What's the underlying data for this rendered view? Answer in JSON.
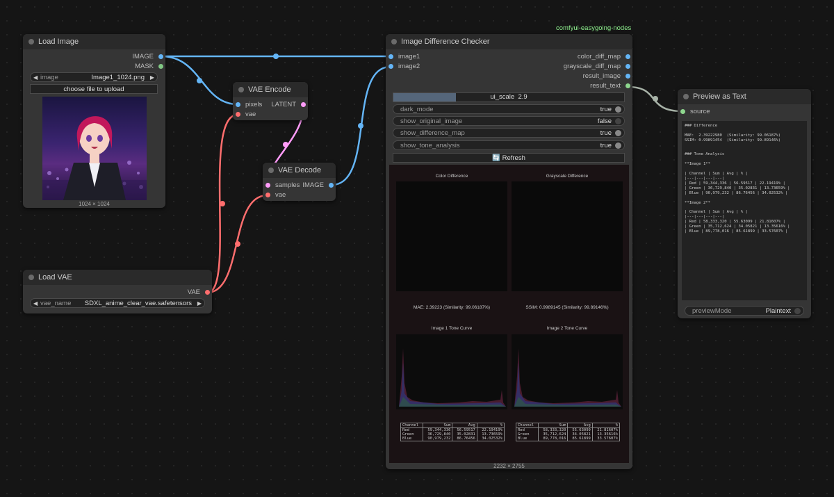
{
  "group_label": "comfyui-easygoing-nodes",
  "nodes": {
    "load_image": {
      "title": "Load Image",
      "out_image": "IMAGE",
      "out_mask": "MASK",
      "image_label": "image",
      "image_value": "Image1_1024.png",
      "upload_label": "choose file to upload",
      "dims": "1024 × 1024"
    },
    "vae_encode": {
      "title": "VAE Encode",
      "in_pixels": "pixels",
      "in_vae": "vae",
      "out_latent": "LATENT"
    },
    "vae_decode": {
      "title": "VAE Decode",
      "in_samples": "samples",
      "in_vae": "vae",
      "out_image": "IMAGE"
    },
    "load_vae": {
      "title": "Load VAE",
      "out_vae": "VAE",
      "vae_name_label": "vae_name",
      "vae_name_value": "SDXL_anime_clear_vae.safetensors"
    },
    "diff_checker": {
      "title": "Image Difference Checker",
      "in_image1": "image1",
      "in_image2": "image2",
      "out_color": "color_diff_map",
      "out_gray": "grayscale_diff_map",
      "out_result_image": "result_image",
      "out_result_text": "result_text",
      "ui_scale_label": "ui_scale",
      "ui_scale_value": "2.9",
      "ui_scale_fraction": 0.27,
      "toggles": [
        {
          "label": "dark_mode",
          "value": "true"
        },
        {
          "label": "show_original_image",
          "value": "false"
        },
        {
          "label": "show_difference_map",
          "value": "true"
        },
        {
          "label": "show_tone_analysis",
          "value": "true"
        }
      ],
      "refresh_label": "🔄 Refresh",
      "color_diff_title": "Color Difference",
      "gray_diff_title": "Grayscale Difference",
      "mae_text": "MAE: 2.39223 (Similarity: 99.06187%)",
      "ssim_text": "SSIM: 0.9989145 (Similarity: 99.89146%)",
      "tone1_title": "Image 1 Tone Curve",
      "tone2_title": "Image 2 Tone Curve",
      "table_headers": [
        "Channel",
        "Sum",
        "Avg",
        "%"
      ],
      "table1": [
        [
          "Red",
          "59,344,336",
          "56.59517",
          "22.19419%"
        ],
        [
          "Green",
          "36,729,840",
          "35.02831",
          "13.73659%"
        ],
        [
          "Blue",
          "90,979,232",
          "86.76456",
          "34.02532%"
        ]
      ],
      "table2": [
        [
          "Red",
          "58,333,320",
          "55.63099",
          "21.81607%"
        ],
        [
          "Green",
          "35,712,624",
          "34.05821",
          "13.35616%"
        ],
        [
          "Blue",
          "89,778,016",
          "85.61899",
          "33.57607%"
        ]
      ],
      "dims": "2232 × 2755"
    },
    "preview_text": {
      "title": "Preview as Text",
      "in_source": "source",
      "lines": [
        "### Difference",
        "",
        "MAE:  2.39222980  (Similarity: 99.06187%)",
        "SSIM: 0.99891454  (Similarity: 99.89146%)",
        "",
        "",
        "### Tone Analysis",
        "",
        "**Image 1**",
        "",
        "| Channel | Sum | Avg | % |",
        "|---|---|---|---|",
        "| Red | 59,344,336 | 56.59517 | 22.19419% |",
        "| Green | 36,729,840 | 35.02831 | 13.73659% |",
        "| Blue | 90,979,232 | 86.76456 | 34.02532% |",
        "",
        "**Image 2**",
        "",
        "| Channel | Sum | Avg | % |",
        "|---|---|---|---|",
        "| Red | 58,333,320 | 55.63099 | 21.81607% |",
        "| Green | 35,712,624 | 34.05821 | 13.35616% |",
        "| Blue | 89,778,016 | 85.61899 | 33.57607% |"
      ],
      "preview_mode_label": "previewMode",
      "preview_mode_value": "Plaintext"
    }
  },
  "colors": {
    "image": "#64b5f6",
    "mask": "#81c784",
    "latent": "#ff9cf9",
    "vae": "#ff6e6e",
    "text": "#8ed78e",
    "group_label": "#8ef08e"
  }
}
